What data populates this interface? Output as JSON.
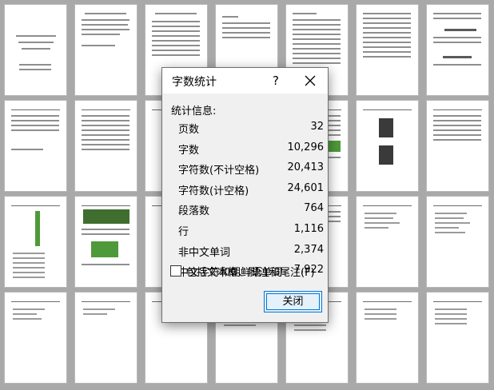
{
  "dialog": {
    "title": "字数统计",
    "help_label": "?",
    "close_icon": "close-icon",
    "section_label": "统计信息:",
    "stats": [
      {
        "label": "页数",
        "value": "32"
      },
      {
        "label": "字数",
        "value": "10,296"
      },
      {
        "label": "字符数(不计空格)",
        "value": "20,413"
      },
      {
        "label": "字符数(计空格)",
        "value": "24,601"
      },
      {
        "label": "段落数",
        "value": "764"
      },
      {
        "label": "行",
        "value": "1,116"
      },
      {
        "label": "非中文单词",
        "value": "2,374"
      },
      {
        "label": "中文字符和朝鲜语单词",
        "value": "7,922"
      }
    ],
    "include_textboxes_label": "包括文本框、脚注和尾注(F)",
    "include_textboxes_checked": false,
    "close_button_label": "关闭"
  },
  "colors": {
    "workspace": "#a9a9a9",
    "accent": "#0078d7",
    "button_bg": "#e5f1fb"
  }
}
